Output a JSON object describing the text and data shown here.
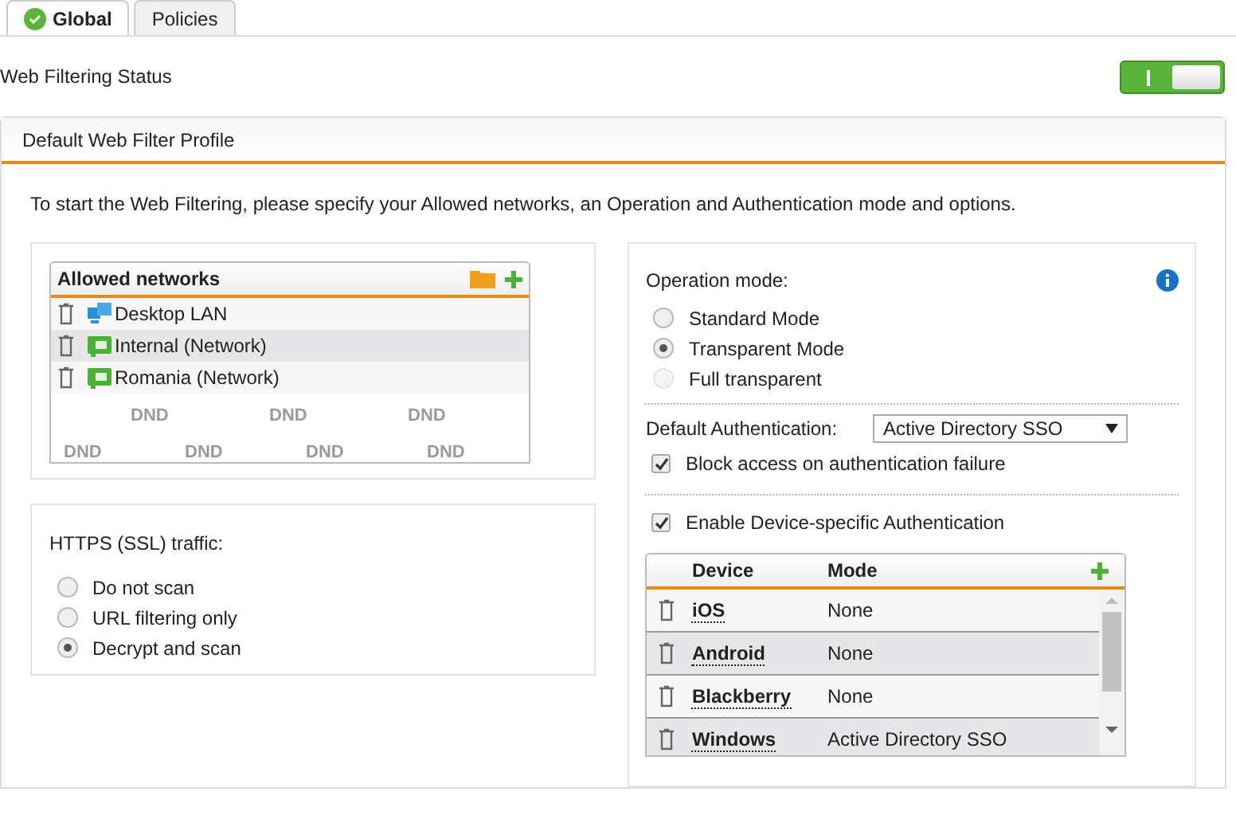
{
  "tabs": [
    {
      "label": "Global",
      "selected": true,
      "kind": "checked"
    },
    {
      "label": "Policies",
      "selected": false,
      "kind": "plain"
    }
  ],
  "status": {
    "label": "Web Filtering Status",
    "on": true
  },
  "profile": {
    "title": "Default Web Filter Profile",
    "intro": "To start the Web Filtering, please specify your Allowed networks, an Operation and Authentication mode and options.",
    "allowed_networks": {
      "title": "Allowed networks",
      "items": [
        {
          "name": "Desktop LAN",
          "kind": "lan",
          "selected": false
        },
        {
          "name": "Internal (Network)",
          "kind": "network",
          "selected": true
        },
        {
          "name": "Romania (Network)",
          "kind": "network",
          "selected": false
        }
      ],
      "drop_marks": [
        "DND",
        "DND",
        "DND",
        "DND",
        "DND",
        "DND",
        "DND"
      ]
    },
    "https": {
      "label": "HTTPS (SSL) traffic:",
      "options": [
        {
          "label": "Do not scan",
          "selected": false
        },
        {
          "label": "URL filtering only",
          "selected": false
        },
        {
          "label": "Decrypt and scan",
          "selected": true
        }
      ]
    },
    "operation_mode": {
      "label": "Operation mode:",
      "options": [
        {
          "label": "Standard Mode",
          "selected": false,
          "disabled": false
        },
        {
          "label": "Transparent Mode",
          "selected": true,
          "disabled": false
        },
        {
          "label": "Full transparent",
          "selected": false,
          "disabled": true
        }
      ]
    },
    "default_auth": {
      "label": "Default Authentication:",
      "value": "Active Directory SSO"
    },
    "block_access": {
      "label": "Block access on authentication failure",
      "checked": true
    },
    "device_auth": {
      "label": "Enable Device-specific Authentication",
      "checked": true
    },
    "devices": {
      "columns": [
        "Device",
        "Mode"
      ],
      "rows": [
        {
          "device": "iOS",
          "mode": "None"
        },
        {
          "device": "Android",
          "mode": "None"
        },
        {
          "device": "Blackberry",
          "mode": "None"
        },
        {
          "device": "Windows",
          "mode": "Active Directory SSO"
        }
      ]
    }
  }
}
